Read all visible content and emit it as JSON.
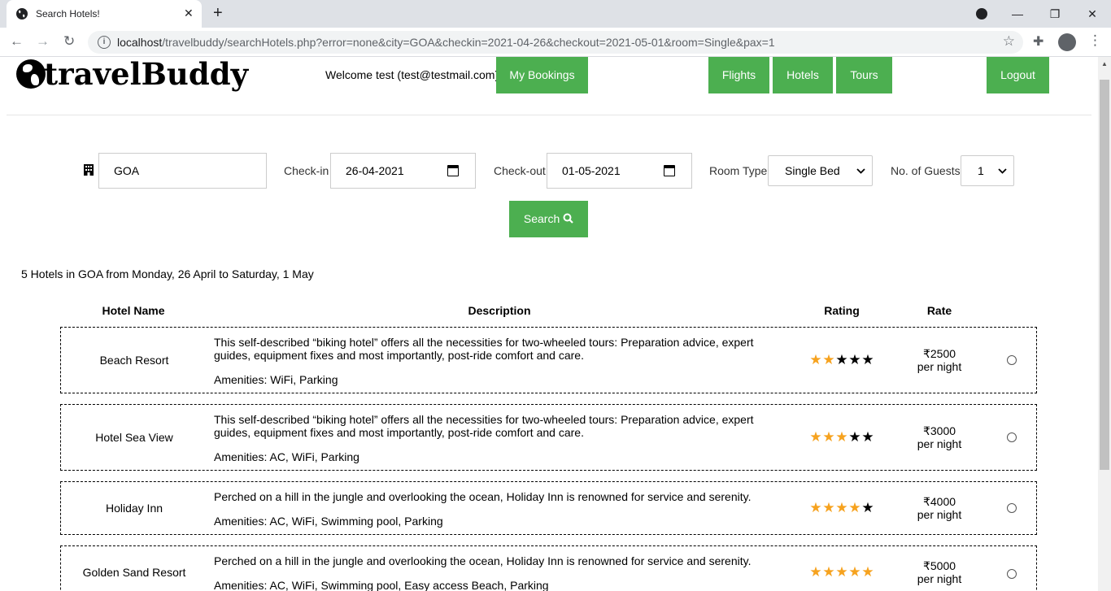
{
  "browser": {
    "tab_title": "Search Hotels!",
    "tab_close": "✕",
    "new_tab": "+",
    "url_host": "localhost",
    "url_path": "/travelbuddy/searchHotels.php?error=none&city=GOA&checkin=2021-04-26&checkout=2021-05-01&room=Single&pax=1",
    "back": "←",
    "forward": "→",
    "reload": "↻",
    "star": "☆",
    "minimize": "—",
    "maximize": "❐",
    "close": "✕",
    "menu": "⋮",
    "extensions": "✚"
  },
  "header": {
    "logo_text": "travelBuddy",
    "welcome": "Welcome test (test@testmail.com)",
    "my_bookings": "My Bookings",
    "flights": "Flights",
    "hotels": "Hotels",
    "tours": "Tours",
    "logout": "Logout"
  },
  "search": {
    "city": "GOA",
    "checkin_label": "Check-in",
    "checkin_value": "26-04-2021",
    "checkout_label": "Check-out",
    "checkout_value": "01-05-2021",
    "room_label": "Room Type",
    "room_value": "Single Bed",
    "guests_label": "No. of Guests",
    "guests_value": "1",
    "search_button": "Search"
  },
  "results": {
    "summary": "5 Hotels in GOA from Monday, 26 April to Saturday, 1 May",
    "columns": {
      "name": "Hotel Name",
      "description": "Description",
      "rating": "Rating",
      "rate": "Rate"
    },
    "hotels": [
      {
        "name": "Beach Resort",
        "description": "This self-described “biking hotel” offers all the necessities for two-wheeled tours: Preparation advice, expert guides, equipment fixes and most importantly, post-ride comfort and care.",
        "amenities": "Amenities: WiFi, Parking",
        "rating": 2,
        "price": "₹2500",
        "per": "per night"
      },
      {
        "name": "Hotel Sea View",
        "description": "This self-described “biking hotel” offers all the necessities for two-wheeled tours: Preparation advice, expert guides, equipment fixes and most importantly, post-ride comfort and care.",
        "amenities": "Amenities: AC, WiFi, Parking",
        "rating": 3,
        "price": "₹3000",
        "per": "per night"
      },
      {
        "name": "Holiday Inn",
        "description": "Perched on a hill in the jungle and overlooking the ocean, Holiday Inn is renowned for service and serenity.",
        "amenities": "Amenities: AC, WiFi, Swimming pool, Parking",
        "rating": 4,
        "price": "₹4000",
        "per": "per night"
      },
      {
        "name": "Golden Sand Resort",
        "description": "Perched on a hill in the jungle and overlooking the ocean, Holiday Inn is renowned for service and serenity.",
        "amenities": "Amenities: AC, WiFi, Swimming pool, Easy access Beach, Parking",
        "rating": 5,
        "price": "₹5000",
        "per": "per night"
      }
    ]
  },
  "colors": {
    "accent": "#4caf50",
    "star_on": "#f6a21e",
    "star_off": "#000000"
  }
}
